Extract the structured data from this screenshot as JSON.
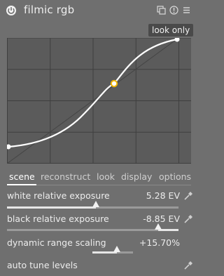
{
  "module": {
    "title": "filmic rgb",
    "icons": [
      "power-icon",
      "presets-icon",
      "reset-icon",
      "menu-icon"
    ]
  },
  "graph": {
    "badge": "look only",
    "colors": {
      "background": "#5b5b5b",
      "grid": "#3f3f3f",
      "curve": "#ffffff",
      "identity": "#4a4a4a",
      "pivot": "#f0b400"
    }
  },
  "tabs": [
    {
      "label": "scene",
      "active": true
    },
    {
      "label": "reconstruct",
      "active": false
    },
    {
      "label": "look",
      "active": false
    },
    {
      "label": "display",
      "active": false
    },
    {
      "label": "options",
      "active": false
    }
  ],
  "params": {
    "white": {
      "label": "white relative exposure",
      "value": "5.28 EV",
      "level": 0.52,
      "picker": "color-picker-icon"
    },
    "black": {
      "label": "black relative exposure",
      "value": "-8.85 EV",
      "level": 0.88,
      "picker": "color-picker-icon"
    },
    "dynamic": {
      "label": "dynamic range scaling",
      "value": "+15.70%",
      "level": 0.6
    },
    "auto": {
      "label": "auto tune levels",
      "picker": "color-picker-icon"
    }
  }
}
